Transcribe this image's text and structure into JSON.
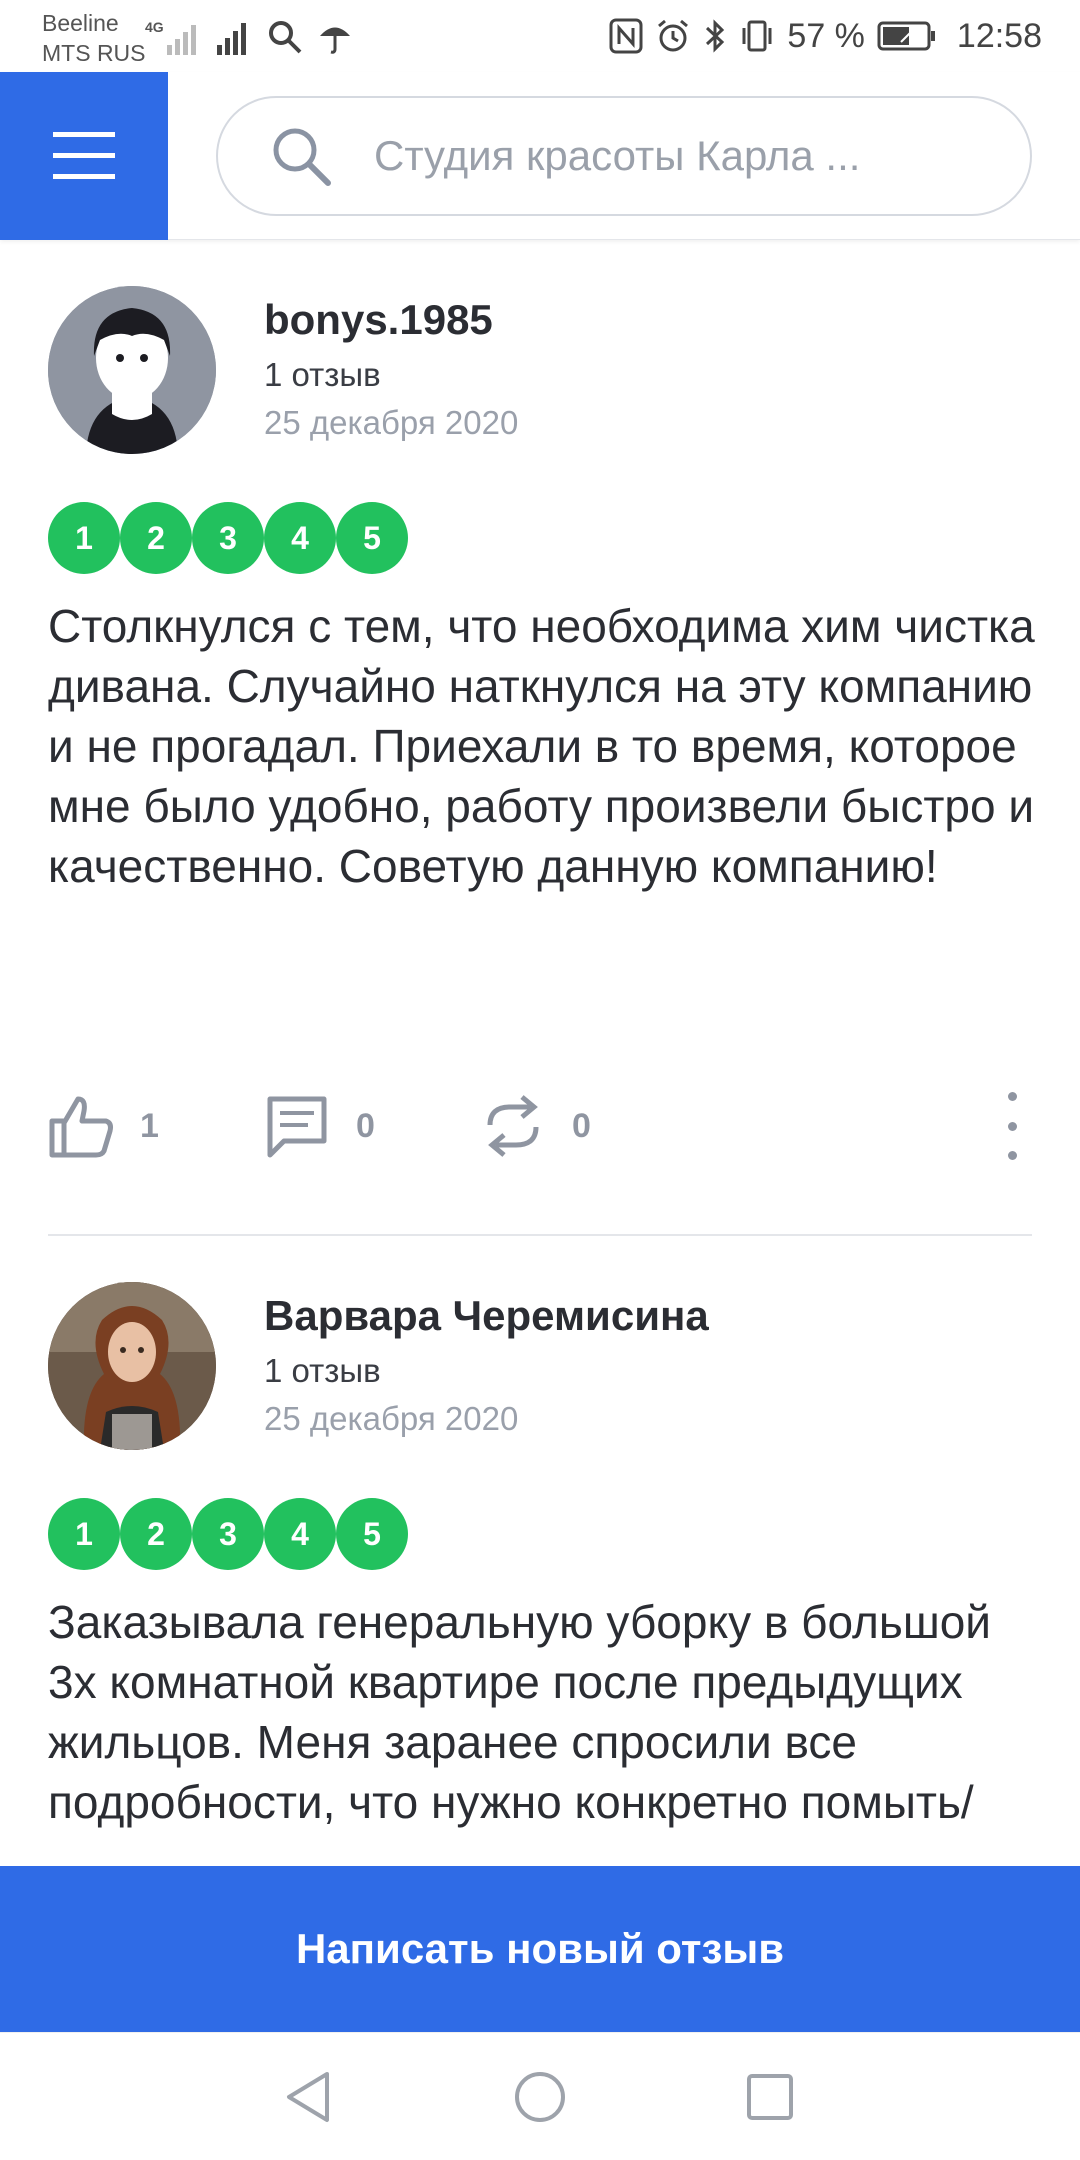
{
  "status_bar": {
    "carrier_1": "Beeline",
    "carrier_2": "MTS RUS",
    "network": "4G",
    "battery": "57 %",
    "time": "12:58"
  },
  "header": {
    "search_text": "Студия красоты Карла ..."
  },
  "reviews": [
    {
      "author": "bonys.1985",
      "review_count": "1 отзыв",
      "date": "25 декабря 2020",
      "rating": [
        "1",
        "2",
        "3",
        "4",
        "5"
      ],
      "text": "Столкнулся с тем, что необходима хим чистка дивана. Случайно наткнулся на эту компанию и не прогадал. Приехали в то время, которое мне было удобно, работу произвели быстро и качественно. Советую данную компанию!",
      "likes": "1",
      "comments": "0",
      "reposts": "0"
    },
    {
      "author": "Варвара Черемисина",
      "review_count": "1 отзыв",
      "date": "25 декабря 2020",
      "rating": [
        "1",
        "2",
        "3",
        "4",
        "5"
      ],
      "text": "Заказывала генеральную уборку в большой 3х комнатной квартире после предыдущих жильцов. Меня заранее спросили все подробности, что нужно конкретно помыть/"
    }
  ],
  "cta_label": "Написать новый отзыв",
  "colors": {
    "brand": "#2f6be6",
    "rating": "#22c15e"
  }
}
